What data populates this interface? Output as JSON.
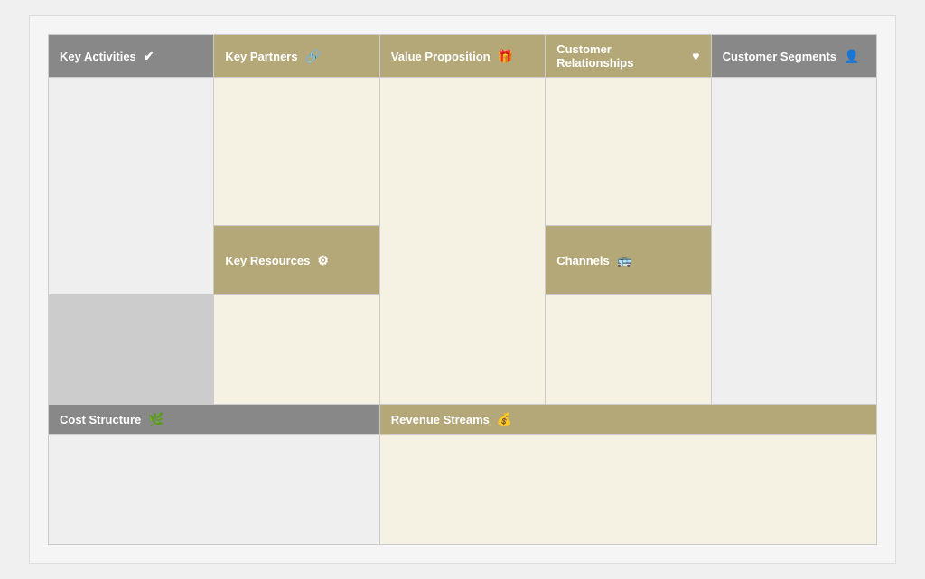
{
  "cells": {
    "key_activities": {
      "label": "Key Activities",
      "icon": "✔"
    },
    "key_partners": {
      "label": "Key Partners",
      "icon": "🔗"
    },
    "value_proposition": {
      "label": "Value Proposition",
      "icon": "🎁"
    },
    "customer_relationships": {
      "label": "Customer Relationships",
      "icon": "♥"
    },
    "customer_segments": {
      "label": "Customer Segments",
      "icon": "👤"
    },
    "key_resources": {
      "label": "Key Resources",
      "icon": "⚙"
    },
    "channels": {
      "label": "Channels",
      "icon": "🚌"
    },
    "cost_structure": {
      "label": "Cost Structure",
      "icon": "🌿"
    },
    "revenue_streams": {
      "label": "Revenue Streams",
      "icon": "💰"
    }
  }
}
